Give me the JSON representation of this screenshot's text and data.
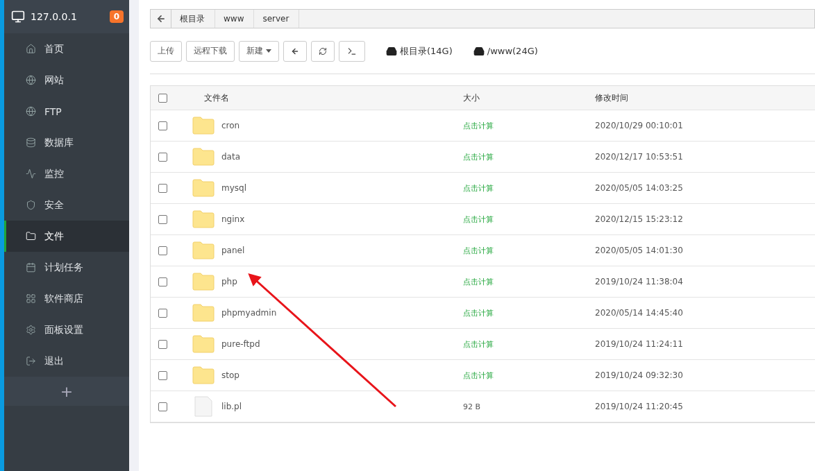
{
  "sidebar": {
    "host": "127.0.0.1",
    "badge": "0",
    "items": [
      {
        "label": "首页",
        "selected": false
      },
      {
        "label": "网站",
        "selected": false
      },
      {
        "label": "FTP",
        "selected": false
      },
      {
        "label": "数据库",
        "selected": false
      },
      {
        "label": "监控",
        "selected": false
      },
      {
        "label": "安全",
        "selected": false
      },
      {
        "label": "文件",
        "selected": true
      },
      {
        "label": "计划任务",
        "selected": false
      },
      {
        "label": "软件商店",
        "selected": false
      },
      {
        "label": "面板设置",
        "selected": false
      },
      {
        "label": "退出",
        "selected": false
      }
    ],
    "add": "+"
  },
  "breadcrumb": [
    "根目录",
    "www",
    "server"
  ],
  "toolbar": {
    "buttons": [
      {
        "kind": "text",
        "label": "上传"
      },
      {
        "kind": "text",
        "label": "远程下载"
      },
      {
        "kind": "dropdown",
        "label": "新建"
      },
      {
        "kind": "back"
      },
      {
        "kind": "refresh"
      },
      {
        "kind": "terminal"
      }
    ],
    "disks": [
      "根目录(14G)",
      "/www(24G)"
    ]
  },
  "table": {
    "columns": [
      "文件名",
      "大小",
      "修改时间"
    ],
    "all_checked": false,
    "rows": [
      {
        "kind": "folder",
        "name": "cron",
        "size": "点击计算",
        "modified": "2020/10/29 00:10:01",
        "checked": false
      },
      {
        "kind": "folder",
        "name": "data",
        "size": "点击计算",
        "modified": "2020/12/17 10:53:51",
        "checked": false
      },
      {
        "kind": "folder",
        "name": "mysql",
        "size": "点击计算",
        "modified": "2020/05/05 14:03:25",
        "checked": false
      },
      {
        "kind": "folder",
        "name": "nginx",
        "size": "点击计算",
        "modified": "2020/12/15 15:23:12",
        "checked": false
      },
      {
        "kind": "folder",
        "name": "panel",
        "size": "点击计算",
        "modified": "2020/05/05 14:01:30",
        "checked": false
      },
      {
        "kind": "folder",
        "name": "php",
        "size": "点击计算",
        "modified": "2019/10/24 11:38:04",
        "checked": false
      },
      {
        "kind": "folder",
        "name": "phpmyadmin",
        "size": "点击计算",
        "modified": "2020/05/14 14:45:40",
        "checked": false
      },
      {
        "kind": "folder",
        "name": "pure-ftpd",
        "size": "点击计算",
        "modified": "2019/10/24 11:24:11",
        "checked": false
      },
      {
        "kind": "folder",
        "name": "stop",
        "size": "点击计算",
        "modified": "2019/10/24 09:32:30",
        "checked": false
      },
      {
        "kind": "file",
        "name": "lib.pl",
        "size": "92 B",
        "modified": "2019/10/24 11:20:45",
        "checked": false
      }
    ]
  }
}
